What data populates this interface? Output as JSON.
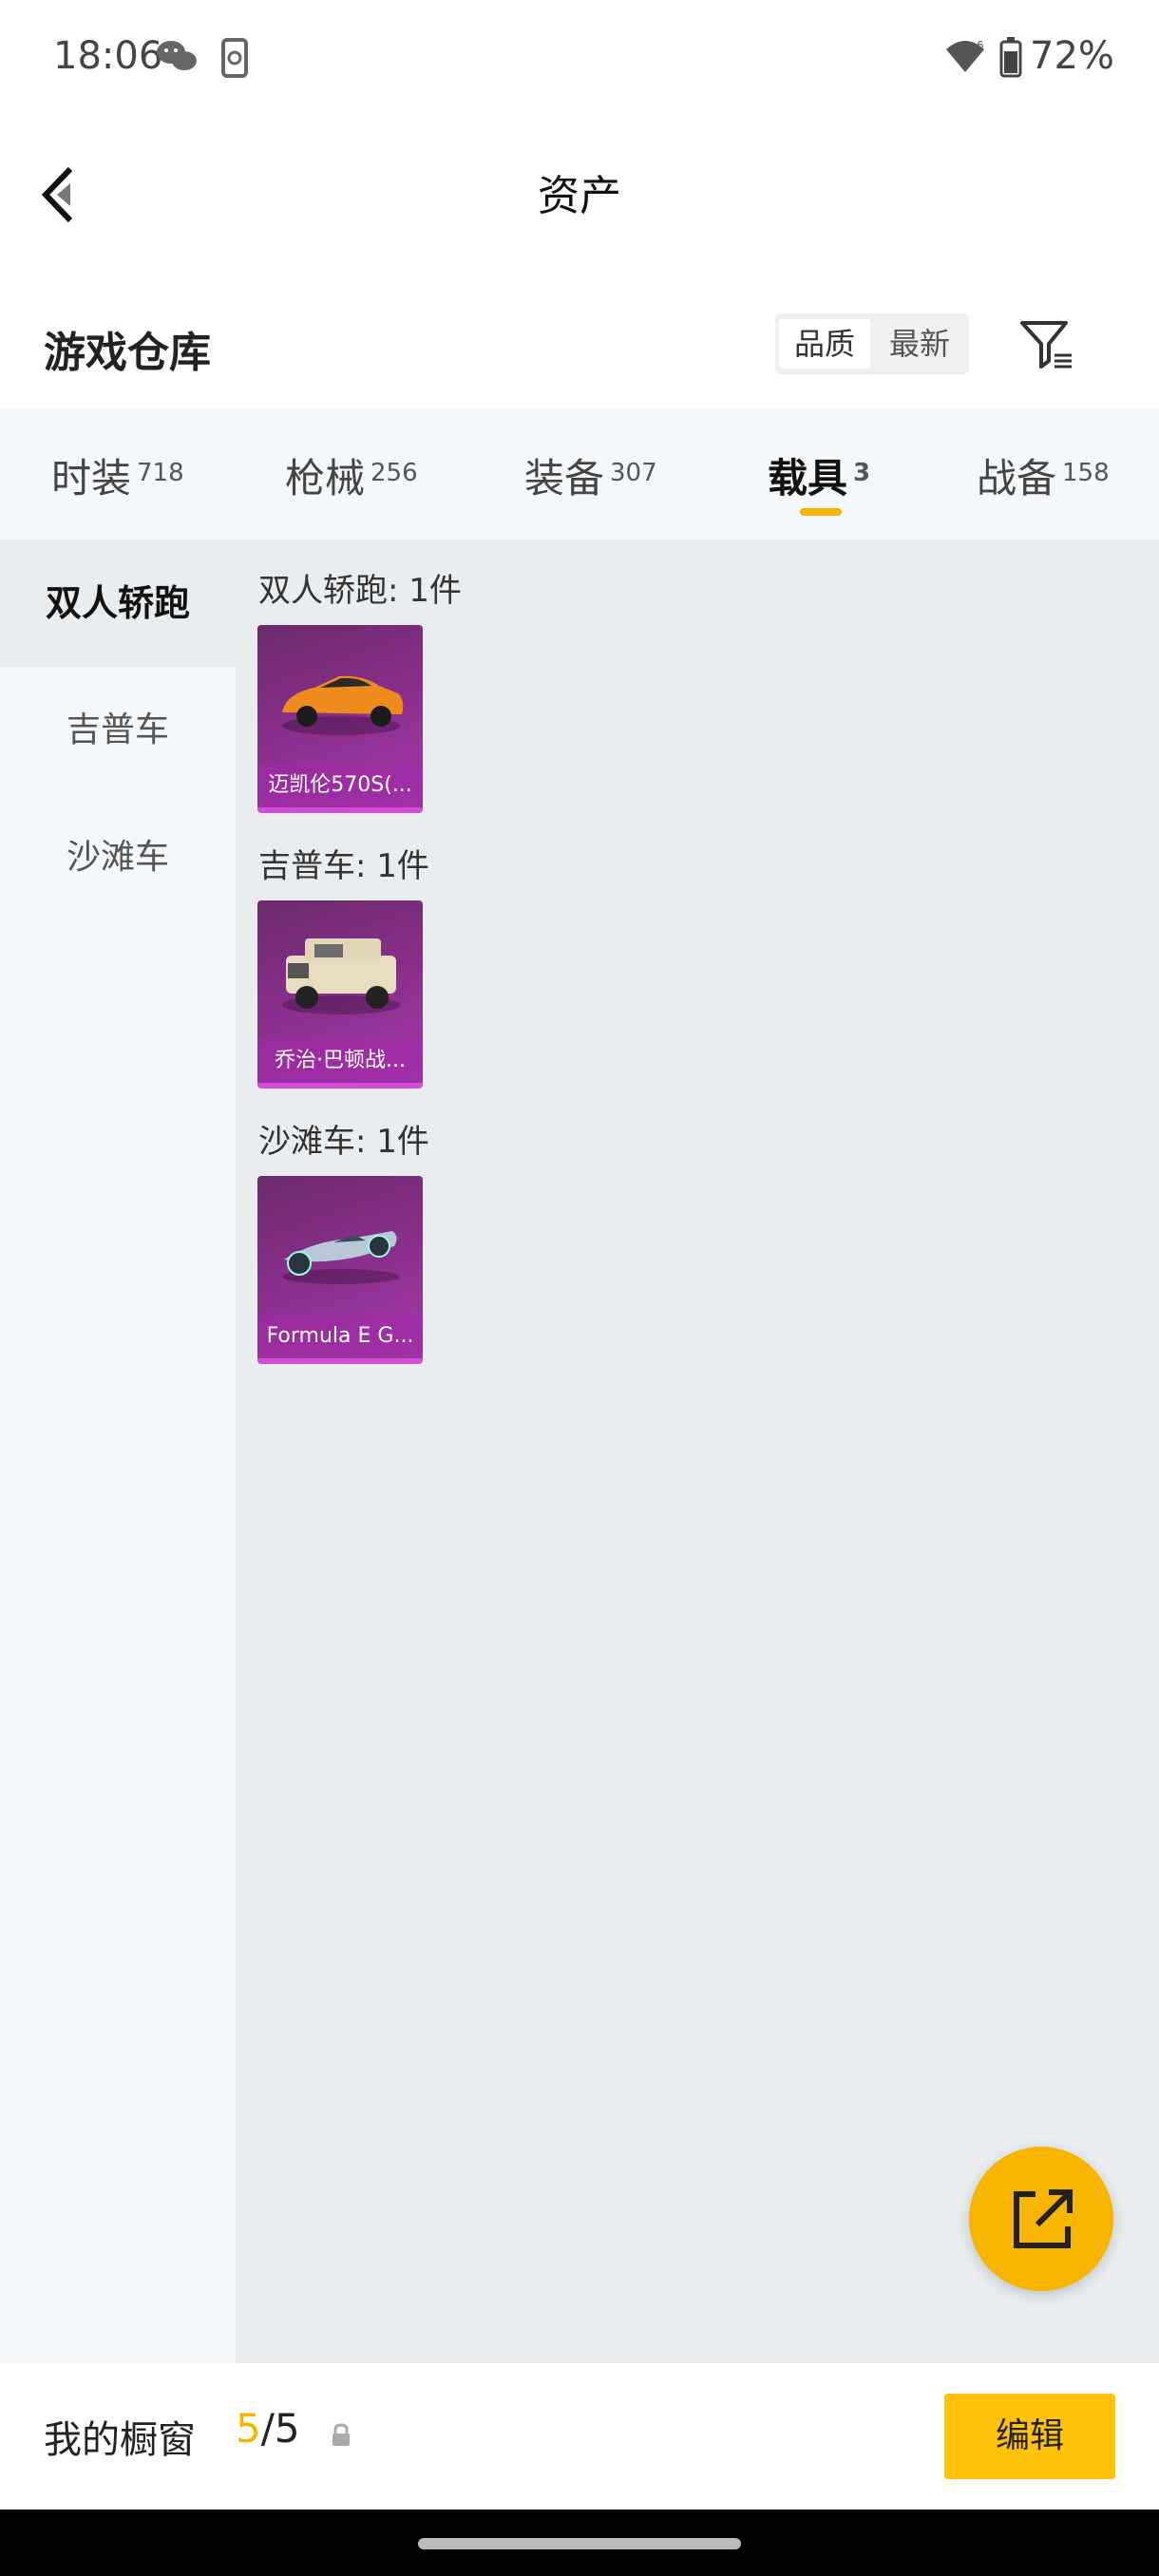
{
  "status_bar": {
    "time": "18:06",
    "battery": "72%",
    "icons": [
      "wechat-icon",
      "phone-sync-icon",
      "wifi-icon",
      "battery-icon"
    ]
  },
  "header": {
    "title": "资产",
    "back_icon": "chevron-left-icon"
  },
  "warehouse": {
    "title": "游戏仓库",
    "sort_options": [
      "品质",
      "最新"
    ],
    "selected_sort": "品质",
    "filter_icon": "filter-icon"
  },
  "tabs": [
    {
      "label": "时装",
      "count": "718"
    },
    {
      "label": "枪械",
      "count": "256"
    },
    {
      "label": "装备",
      "count": "307"
    },
    {
      "label": "载具",
      "count": "3",
      "active": true
    },
    {
      "label": "战备",
      "count": "158"
    }
  ],
  "sidebar": {
    "items": [
      {
        "label": "双人轿跑",
        "active": true
      },
      {
        "label": "吉普车"
      },
      {
        "label": "沙滩车"
      }
    ]
  },
  "groups": [
    {
      "title": "双人轿跑: 1件",
      "items": [
        {
          "name": "迈凯伦570S(..."
        }
      ]
    },
    {
      "title": "吉普车: 1件",
      "items": [
        {
          "name": "乔治·巴顿战..."
        }
      ]
    },
    {
      "title": "沙滩车: 1件",
      "items": [
        {
          "name": "Formula E G..."
        }
      ]
    }
  ],
  "fab": {
    "icon": "share-external-icon"
  },
  "bottom_bar": {
    "label": "我的橱窗",
    "current": "5",
    "total": "/5",
    "lock_icon": "lock-icon",
    "edit_label": "编辑"
  },
  "colors": {
    "accent": "#f7b500",
    "card_purple": "#8c2f8f",
    "card_border": "#d24ed6"
  }
}
